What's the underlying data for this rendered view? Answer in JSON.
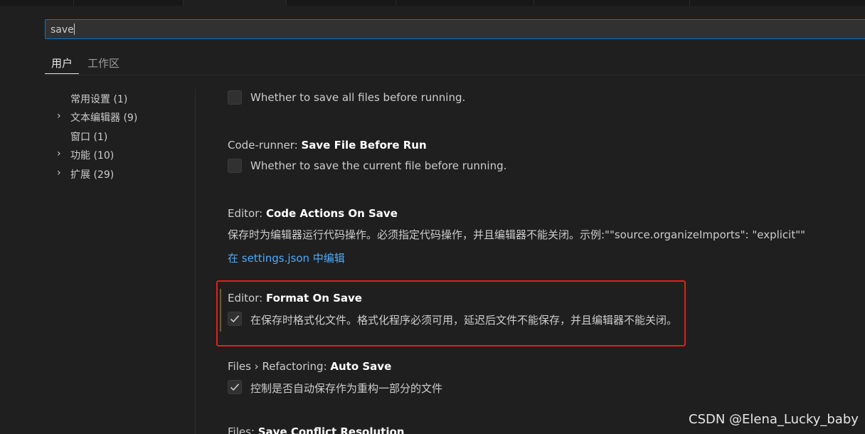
{
  "search": {
    "value": "save"
  },
  "scope_tabs": [
    {
      "label": "用户",
      "active": true
    },
    {
      "label": "工作区",
      "active": false
    }
  ],
  "toc": [
    {
      "label": "常用设置 (1)",
      "expandable": false
    },
    {
      "label": "文本编辑器 (9)",
      "expandable": true
    },
    {
      "label": "窗口 (1)",
      "expandable": false
    },
    {
      "label": "功能 (10)",
      "expandable": true
    },
    {
      "label": "扩展 (29)",
      "expandable": true
    }
  ],
  "settings": {
    "save_all": {
      "checked": false,
      "label": "Whether to save all files before running."
    },
    "save_file": {
      "category": "Code-runner: ",
      "name": "Save File Before Run",
      "checked": false,
      "label": "Whether to save the current file before running."
    },
    "code_actions": {
      "category": "Editor: ",
      "name": "Code Actions On Save",
      "description": "保存时为编辑器运行代码操作。必须指定代码操作，并且编辑器不能关闭。示例:\"\"source.organizeImports\": \"explicit\"\"",
      "link": "在 settings.json 中编辑"
    },
    "format_on_save": {
      "category": "Editor: ",
      "name": "Format On Save",
      "checked": true,
      "label": "在保存时格式化文件。格式化程序必须可用，延迟后文件不能保存，并且编辑器不能关闭。"
    },
    "auto_save": {
      "category": "Files › Refactoring: ",
      "name": "Auto Save",
      "checked": true,
      "label": "控制是否自动保存作为重构一部分的文件"
    },
    "conflict": {
      "category": "Files: ",
      "name": "Save Conflict Resolution"
    }
  },
  "watermark": "CSDN @Elena_Lucky_baby",
  "colors": {
    "accent": "#0078d4",
    "link": "#4daafc",
    "highlight": "#e0211b",
    "background": "#1f1f1f"
  }
}
